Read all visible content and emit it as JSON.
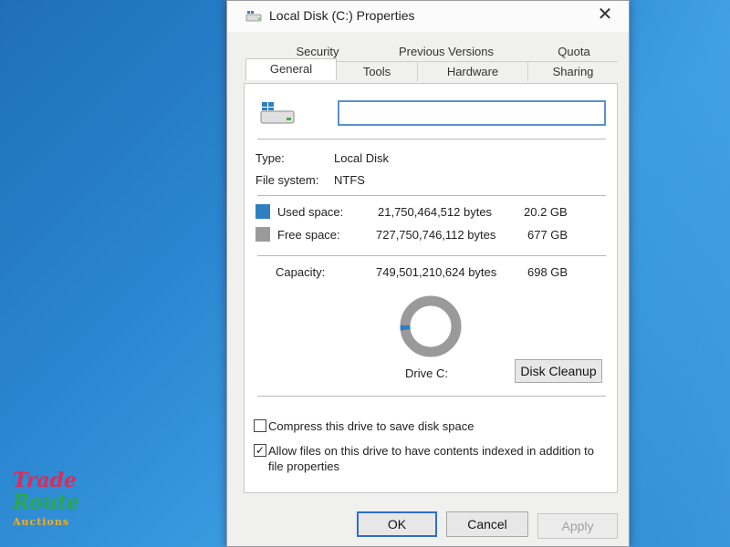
{
  "window": {
    "title": "Local Disk (C:) Properties"
  },
  "tabs": {
    "row1": [
      "Security",
      "Previous Versions",
      "Quota"
    ],
    "row2": [
      "General",
      "Tools",
      "Hardware",
      "Sharing"
    ],
    "active": "General"
  },
  "general": {
    "name_value": "",
    "type_label": "Type:",
    "type_value": "Local Disk",
    "fs_label": "File system:",
    "fs_value": "NTFS",
    "used_label": "Used space:",
    "used_bytes": "21,750,464,512 bytes",
    "used_gb": "20.2 GB",
    "free_label": "Free space:",
    "free_bytes": "727,750,746,112 bytes",
    "free_gb": "677 GB",
    "capacity_label": "Capacity:",
    "capacity_bytes": "749,501,210,624 bytes",
    "capacity_gb": "698 GB",
    "drive_label": "Drive C:",
    "used_fraction": 0.029,
    "disk_cleanup_label": "Disk Cleanup",
    "compress_label": "Compress this drive to save disk space",
    "compress_checked": false,
    "index_label_1": "Allow files on this drive to have contents indexed in addition to",
    "index_label_2": "file properties",
    "index_checked": true
  },
  "buttons": {
    "ok": "OK",
    "cancel": "Cancel",
    "apply": "Apply"
  },
  "watermark": {
    "line1": "Trade",
    "line2": "Route",
    "line3": "Auctions"
  },
  "colors": {
    "used": "#2f7fc0",
    "free": "#9a9a9a",
    "accent": "#2e6fc7"
  },
  "icons": {
    "close": "close-icon",
    "drive": "drive-icon",
    "check": "checkmark-icon"
  }
}
